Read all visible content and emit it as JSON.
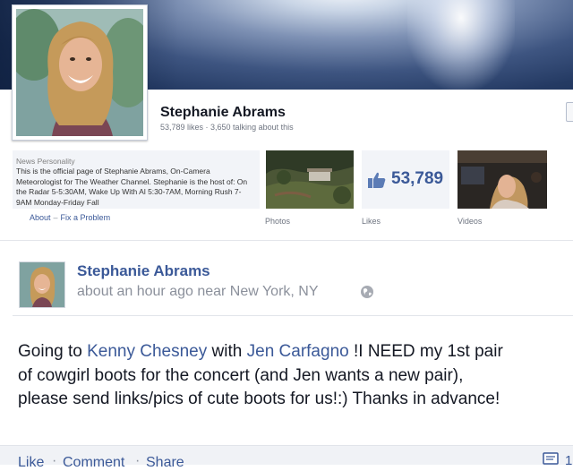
{
  "page": {
    "name": "Stephanie Abrams",
    "stats": "53,789 likes · 3,650 talking about this"
  },
  "about": {
    "category": "News Personality",
    "text": "This is the official page of Stephanie Abrams, On-Camera Meteorologist for The Weather Channel. Stephanie is the host of: On the Radar 5-5:30AM, Wake Up With Al 5:30-7AM, Morning Rush 7-9AM Monday-Friday Fall",
    "links": [
      "About",
      "Fix a Problem"
    ]
  },
  "tiles": {
    "photos_label": "Photos",
    "likes_count": "53,789",
    "likes_label": "Likes",
    "videos_label": "Videos"
  },
  "post": {
    "author": "Stephanie Abrams",
    "meta": "about an hour ago near New York, NY",
    "body": {
      "lead": "Going to ",
      "tag1": "Kenny Chesney",
      "mid": " with ",
      "tag2": "Jen Carfagno",
      "after": " !I NEED my 1st pair",
      "line2": "of cowgirl boots for the concert (and Jen wants a new pair),",
      "line3": "please send links/pics of cute boots for us!:) Thanks in advance!"
    },
    "actions": [
      "Like",
      "Comment",
      "Share"
    ],
    "action_sep": "·",
    "comment_count": "1"
  },
  "icons": [
    "thumbs-up-icon",
    "globe-icon",
    "comment-icon"
  ],
  "colors": {
    "link": "#3b5998",
    "text": "#141823",
    "muted": "#8b909b"
  }
}
